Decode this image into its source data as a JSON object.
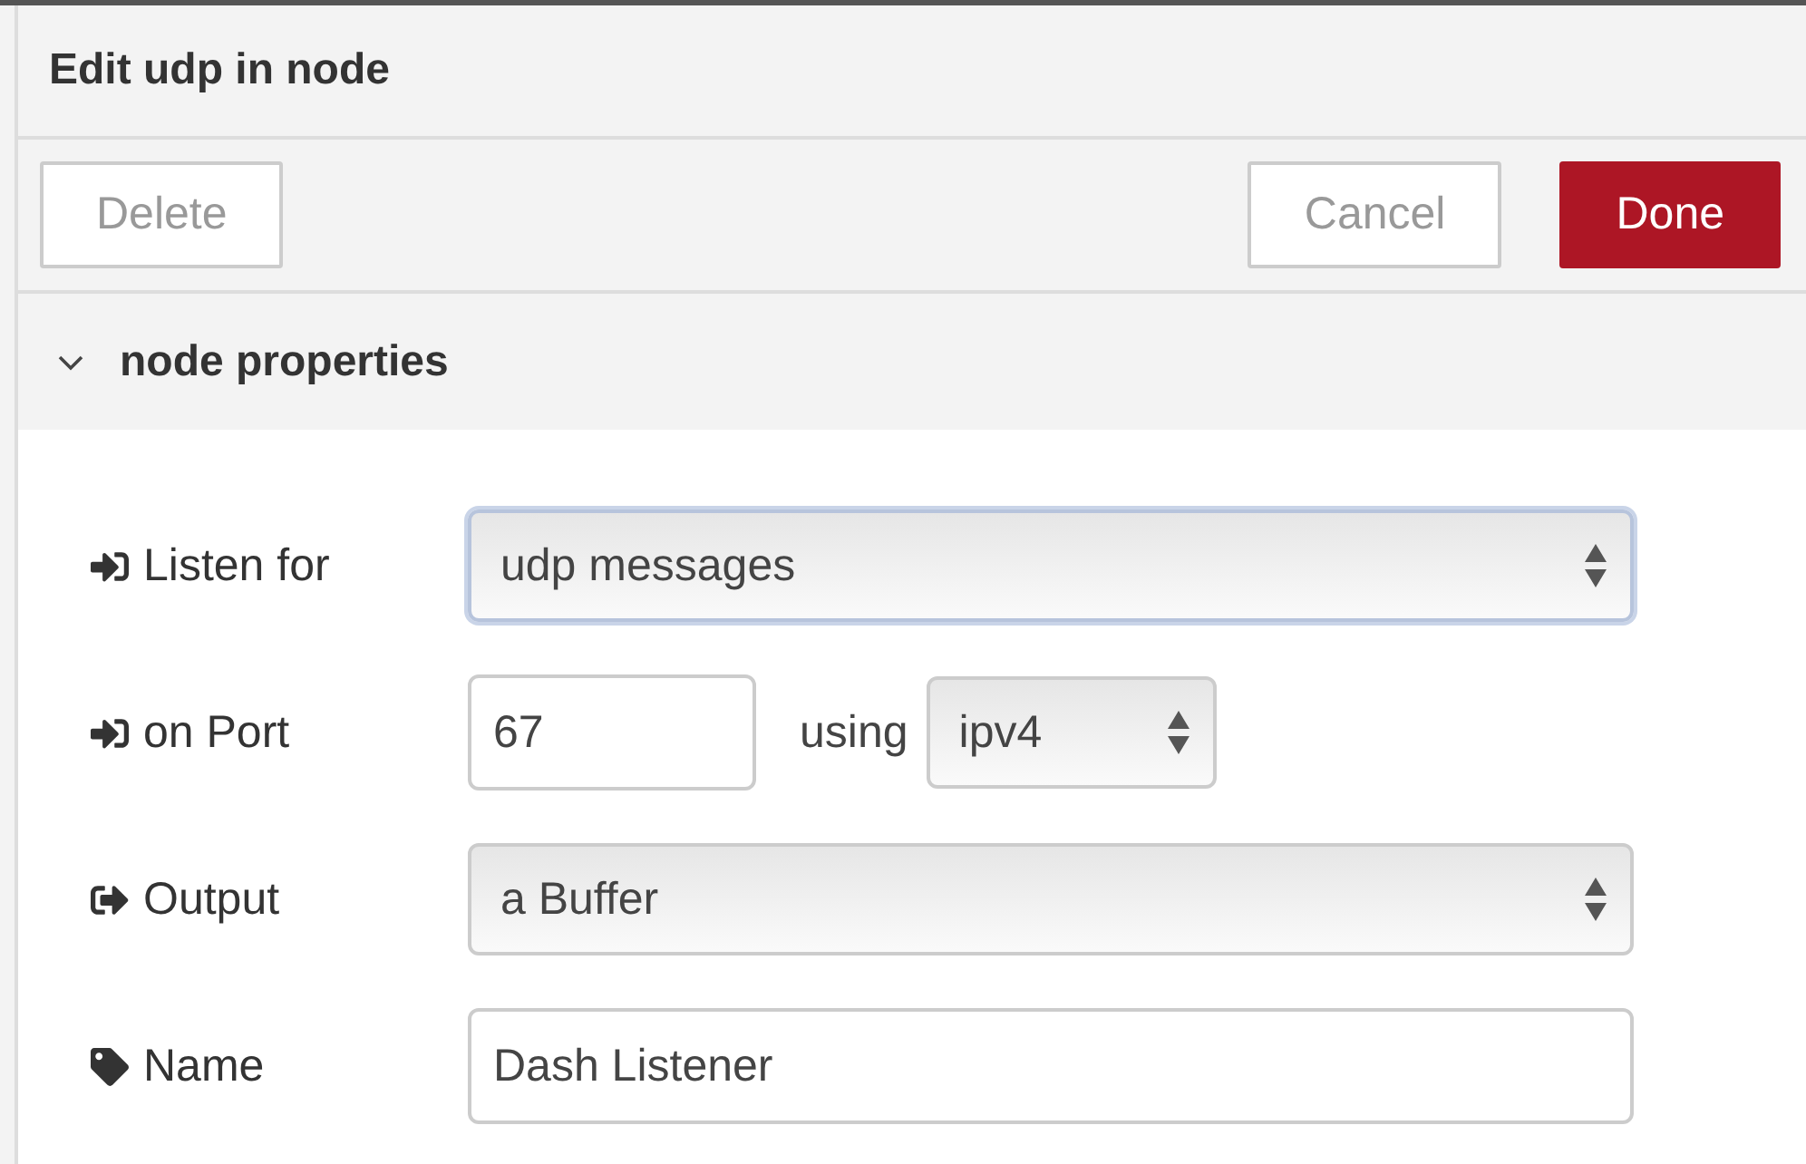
{
  "title": "Edit udp in node",
  "buttons": [
    {
      "label": "Delete",
      "kind": "secondary"
    },
    {
      "label": "Cancel",
      "kind": "secondary"
    },
    {
      "label": "Done",
      "kind": "primary"
    }
  ],
  "section": {
    "title": "node properties",
    "expanded": true
  },
  "rows": [
    {
      "kind": "select",
      "label": "Listen for",
      "value": "udp messages",
      "focused": true
    },
    {
      "kind": "port",
      "label": "on Port",
      "value": "67",
      "connector": "using",
      "select_value": "ipv4"
    },
    {
      "kind": "select",
      "label": "Output",
      "value": "a Buffer",
      "focused": false
    },
    {
      "kind": "text",
      "label": "Name",
      "value": "Dash Listener"
    }
  ]
}
